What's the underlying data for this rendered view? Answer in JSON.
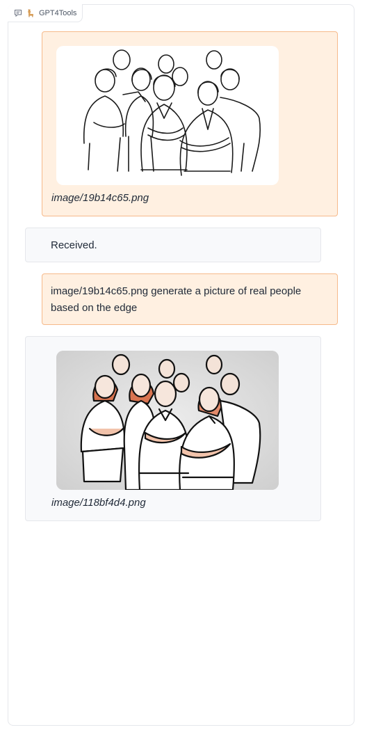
{
  "app": {
    "tab_label": "GPT4Tools",
    "chat_icon": "chat-bubble-icon",
    "logo_icon": "llama-icon"
  },
  "messages": [
    {
      "role": "user",
      "type": "image",
      "caption": "image/19b14c65.png",
      "image": "line-drawing-group-of-people"
    },
    {
      "role": "bot",
      "type": "text",
      "text": "Received."
    },
    {
      "role": "user",
      "type": "text",
      "line1": "image/19b14c65.png generate a picture of real people",
      "line2": "based on the edge"
    },
    {
      "role": "bot",
      "type": "image",
      "caption": "image/118bf4d4.png",
      "image": "generated-group-of-people"
    }
  ],
  "colors": {
    "user_bg": "#fff0e1",
    "user_border": "#f6b98a",
    "bot_bg": "#f8f9fb",
    "bot_border": "#e5e7eb"
  }
}
